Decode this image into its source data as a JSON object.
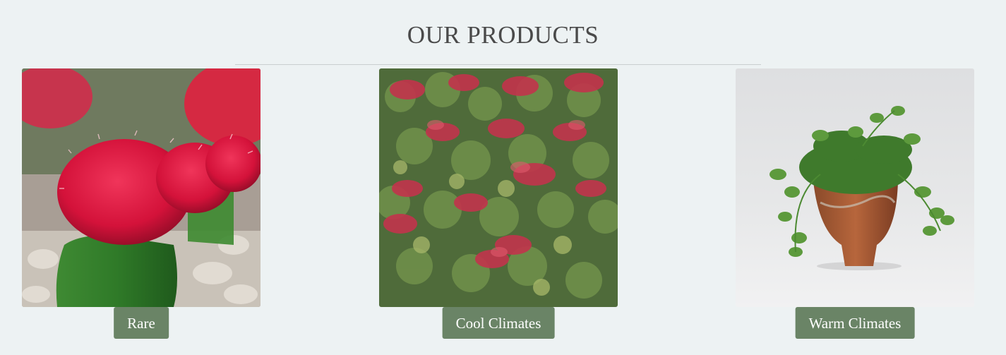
{
  "section": {
    "title": "OUR PRODUCTS"
  },
  "products": [
    {
      "label": "Rare",
      "image": "red-moon-cactus-photo"
    },
    {
      "label": "Cool Climates",
      "image": "red-sedum-groundcover-photo"
    },
    {
      "label": "Warm Climates",
      "image": "trailing-succulent-in-clay-pot-photo"
    }
  ],
  "colors": {
    "background": "#edf2f3",
    "button": "#6a8466",
    "button_text": "#ffffff",
    "heading": "#4a4a4a"
  }
}
